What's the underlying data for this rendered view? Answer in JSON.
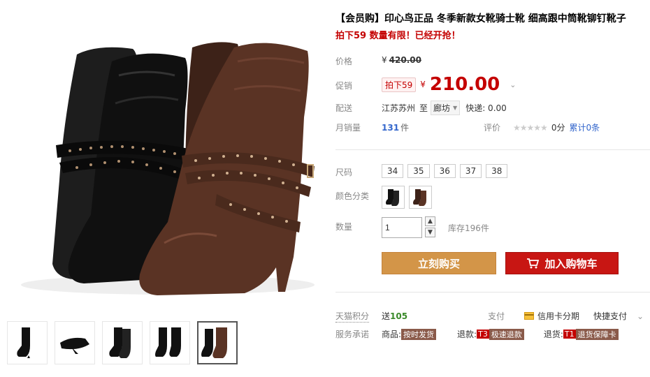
{
  "product": {
    "title": "【会员购】印心鸟正品 冬季新款女靴骑士靴 细高跟中筒靴铆钉靴子",
    "subtitle": "拍下59 数量有限！已经开抢！"
  },
  "price": {
    "label": "价格",
    "currency": "¥",
    "original": "420.00"
  },
  "promo": {
    "label": "促销",
    "badge": "拍下59",
    "currency": "¥",
    "price": "210.00",
    "caret": "⌄"
  },
  "delivery": {
    "label": "配送",
    "from": "江苏苏州",
    "to_word": "至",
    "destination": "廊坊",
    "shipping": "快递: 0.00"
  },
  "sales": {
    "label": "月销量",
    "count": "131",
    "unit": "件",
    "rating_label": "评价",
    "stars": "★★★★★",
    "score": "0分",
    "review_count": "累计0条"
  },
  "sizes": {
    "label": "尺码",
    "options": [
      "34",
      "35",
      "36",
      "37",
      "38"
    ]
  },
  "colors": {
    "label": "颜色分类",
    "options": [
      "black",
      "brown"
    ]
  },
  "quantity": {
    "label": "数量",
    "value": "1",
    "up": "▲",
    "down": "▼",
    "stock": "库存196件"
  },
  "buttons": {
    "buy": "立刻购买",
    "cart": "加入购物车"
  },
  "points": {
    "label": "天猫积分",
    "send": "送",
    "amount": "105",
    "pay_label": "支付",
    "credit": "信用卡分期",
    "quick": "快捷支付",
    "caret": "⌄"
  },
  "service": {
    "label": "服务承诺",
    "goods": "商品:",
    "goods_tag": "按时发货",
    "refund": "退款:",
    "refund_badge": "T3",
    "refund_tag": "极速退款",
    "return": "退货:",
    "return_badge": "T1",
    "return_tag": "退货保障卡"
  },
  "colors_theme": {
    "accent_red": "#c40000",
    "buy_orange": "#d39548",
    "cart_red": "#c81613",
    "link_blue": "#3366cc"
  }
}
